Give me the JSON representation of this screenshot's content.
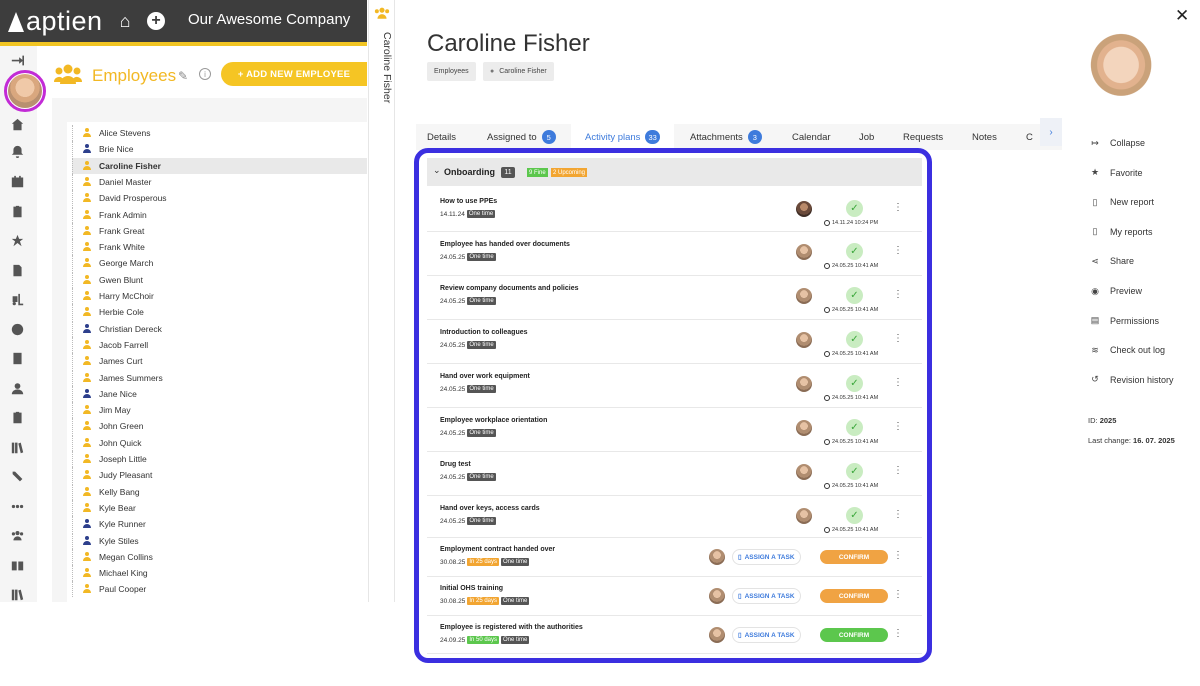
{
  "app": {
    "brand": "aptien",
    "company": "Our Awesome Company"
  },
  "employees_panel": {
    "title": "Employees",
    "add_button": "+ ADD NEW EMPLOYEE",
    "list": [
      {
        "name": "Alice Stevens",
        "color": "#f2b824"
      },
      {
        "name": "Brie Nice",
        "color": "#2d3f8c"
      },
      {
        "name": "Caroline Fisher",
        "color": "#f2b824",
        "selected": true
      },
      {
        "name": "Daniel Master",
        "color": "#f2b824"
      },
      {
        "name": "David Prosperous",
        "color": "#f2b824"
      },
      {
        "name": "Frank Admin",
        "color": "#f2b824"
      },
      {
        "name": "Frank Great",
        "color": "#f2b824"
      },
      {
        "name": "Frank White",
        "color": "#f2b824"
      },
      {
        "name": "George March",
        "color": "#f2b824"
      },
      {
        "name": "Gwen Blunt",
        "color": "#f2b824"
      },
      {
        "name": "Harry McChoir",
        "color": "#f2b824"
      },
      {
        "name": "Herbie Cole",
        "color": "#f2b824"
      },
      {
        "name": "Christian Dereck",
        "color": "#2d3f8c"
      },
      {
        "name": "Jacob Farrell",
        "color": "#f2b824"
      },
      {
        "name": "James Curt",
        "color": "#f2b824"
      },
      {
        "name": "James Summers",
        "color": "#f2b824"
      },
      {
        "name": "Jane Nice",
        "color": "#2d3f8c"
      },
      {
        "name": "Jim May",
        "color": "#f2b824"
      },
      {
        "name": "John Green",
        "color": "#f2b824"
      },
      {
        "name": "John Quick",
        "color": "#f2b824"
      },
      {
        "name": "Joseph Little",
        "color": "#f2b824"
      },
      {
        "name": "Judy Pleasant",
        "color": "#f2b824"
      },
      {
        "name": "Kelly Bang",
        "color": "#f2b824"
      },
      {
        "name": "Kyle Bear",
        "color": "#f2b824"
      },
      {
        "name": "Kyle Runner",
        "color": "#2d3f8c"
      },
      {
        "name": "Kyle Stiles",
        "color": "#2d3f8c"
      },
      {
        "name": "Megan Collins",
        "color": "#f2b824"
      },
      {
        "name": "Michael King",
        "color": "#f2b824"
      },
      {
        "name": "Paul Cooper",
        "color": "#f2b824"
      }
    ]
  },
  "detail": {
    "vertical_name": "Caroline Fisher",
    "name": "Caroline Fisher",
    "breadcrumb": [
      "Employees",
      "Caroline Fisher"
    ],
    "tabs": [
      {
        "label": "Details"
      },
      {
        "label": "Assigned to",
        "count": "5"
      },
      {
        "label": "Activity plans",
        "count": "33",
        "active": true
      },
      {
        "label": "Attachments",
        "count": "3"
      },
      {
        "label": "Calendar"
      },
      {
        "label": "Job"
      },
      {
        "label": "Requests"
      },
      {
        "label": "Notes"
      },
      {
        "label": "C"
      }
    ],
    "section": {
      "title": "Onboarding",
      "count": "11",
      "fine": "9 Fine",
      "upcoming": "2 Upcoming"
    },
    "activities": [
      {
        "title": "How to use PPEs",
        "date": "14.11.24",
        "badges": [
          {
            "text": "One time",
            "kind": "dark"
          }
        ],
        "status": "done",
        "stamp": "14.11.24 10:24 PM",
        "avatar": "dark"
      },
      {
        "title": "Employee has handed over documents",
        "date": "24.05.25",
        "badges": [
          {
            "text": "One time",
            "kind": "dark"
          }
        ],
        "status": "done",
        "stamp": "24.05.25 10:41 AM",
        "avatar": "light"
      },
      {
        "title": "Review company documents and policies",
        "date": "24.05.25",
        "badges": [
          {
            "text": "One time",
            "kind": "dark"
          }
        ],
        "status": "done",
        "stamp": "24.05.25 10:41 AM",
        "avatar": "light"
      },
      {
        "title": "Introduction to colleagues",
        "date": "24.05.25",
        "badges": [
          {
            "text": "One time",
            "kind": "dark"
          }
        ],
        "status": "done",
        "stamp": "24.05.25 10:41 AM",
        "avatar": "light"
      },
      {
        "title": "Hand over work equipment",
        "date": "24.05.25",
        "badges": [
          {
            "text": "One time",
            "kind": "dark"
          }
        ],
        "status": "done",
        "stamp": "24.05.25 10:41 AM",
        "avatar": "light"
      },
      {
        "title": "Employee workplace orientation",
        "date": "24.05.25",
        "badges": [
          {
            "text": "One time",
            "kind": "dark"
          }
        ],
        "status": "done",
        "stamp": "24.05.25 10:41 AM",
        "avatar": "light"
      },
      {
        "title": "Drug test",
        "date": "24.05.25",
        "badges": [
          {
            "text": "One time",
            "kind": "dark"
          }
        ],
        "status": "done",
        "stamp": "24.05.25 10:41 AM",
        "avatar": "light"
      },
      {
        "title": "Hand over keys, access cards",
        "date": "24.05.25",
        "badges": [
          {
            "text": "One time",
            "kind": "dark"
          }
        ],
        "status": "done",
        "stamp": "24.05.25 10:41 AM",
        "avatar": "light"
      },
      {
        "title": "Employment contract handed over",
        "date": "30.08.25",
        "badges": [
          {
            "text": "In 25 days",
            "kind": "orange"
          },
          {
            "text": "One time",
            "kind": "dark"
          }
        ],
        "status": "pending",
        "assign": "ASSIGN A TASK",
        "confirm": "CONFIRM",
        "confirm_kind": "orange",
        "avatar": "light"
      },
      {
        "title": "Initial OHS training",
        "date": "30.08.25",
        "badges": [
          {
            "text": "In 25 days",
            "kind": "orange"
          },
          {
            "text": "One time",
            "kind": "dark"
          }
        ],
        "status": "pending",
        "assign": "ASSIGN A TASK",
        "confirm": "CONFIRM",
        "confirm_kind": "orange",
        "avatar": "light"
      },
      {
        "title": "Employee is registered with the authorities",
        "date": "24.09.25",
        "badges": [
          {
            "text": "In 50 days",
            "kind": "green"
          },
          {
            "text": "One time",
            "kind": "dark"
          }
        ],
        "status": "pending",
        "assign": "ASSIGN A TASK",
        "confirm": "CONFIRM",
        "confirm_kind": "green",
        "avatar": "light"
      }
    ],
    "actions": [
      {
        "label": "Collapse",
        "icon": "collapse-icon",
        "glyph": "↦"
      },
      {
        "label": "Favorite",
        "icon": "star-icon",
        "glyph": "★"
      },
      {
        "label": "New report",
        "icon": "report-icon",
        "glyph": "▯"
      },
      {
        "label": "My reports",
        "icon": "reports-icon",
        "glyph": "▯"
      },
      {
        "label": "Share",
        "icon": "share-icon",
        "glyph": "⋖"
      },
      {
        "label": "Preview",
        "icon": "eye-icon",
        "glyph": "◉"
      },
      {
        "label": "Permissions",
        "icon": "permissions-icon",
        "glyph": "▤"
      },
      {
        "label": "Check out log",
        "icon": "log-icon",
        "glyph": "≋"
      },
      {
        "label": "Revision history",
        "icon": "history-icon",
        "glyph": "↺"
      }
    ],
    "meta": {
      "id_label": "ID:",
      "id_value": "2025",
      "change_label": "Last change:",
      "change_value": "16. 07. 2025"
    }
  },
  "colors": {
    "accent_yellow": "#f2c523",
    "accent_blue": "#3e7bdc",
    "highlight_frame": "#3b2fe0"
  }
}
